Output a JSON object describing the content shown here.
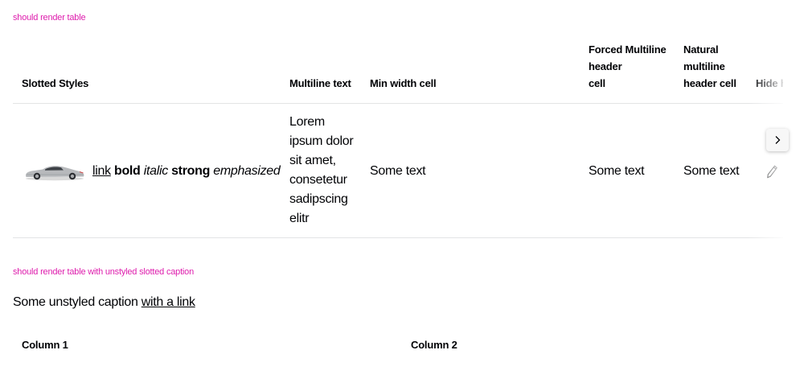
{
  "story1": {
    "label": "should render table",
    "headers": {
      "slotted_styles": "Slotted Styles",
      "multiline_text": "Multiline text",
      "min_width_cell": "Min width cell",
      "forced_multiline": [
        "Forced Multiline",
        "header",
        "cell"
      ],
      "natural_multiline": [
        "Natural",
        "multiline",
        "header cell"
      ],
      "hide_header": "Hide h"
    },
    "row": {
      "image_alt": "car",
      "link": "link",
      "bold": "bold",
      "italic": "italic",
      "strong": "strong",
      "emphasized": "emphasized",
      "multiline_text": "Lorem ipsum dolor sit amet, consetetur sadipscing elitr",
      "min_width_cell": "Some text",
      "forced_multiline": "Some text",
      "natural_multiline": "Some text",
      "hide_header_icon": "edit-icon"
    },
    "scroll_icon": "chevron-right-icon"
  },
  "story2": {
    "label": "should render table with unstyled slotted caption",
    "caption_text": "Some unstyled caption ",
    "caption_link": "with a link",
    "headers": {
      "col1": "Column 1",
      "col2": "Column 2"
    }
  },
  "colors": {
    "story_label": "#de1dad",
    "text": "#010205",
    "divider": "#e3e4e5"
  }
}
